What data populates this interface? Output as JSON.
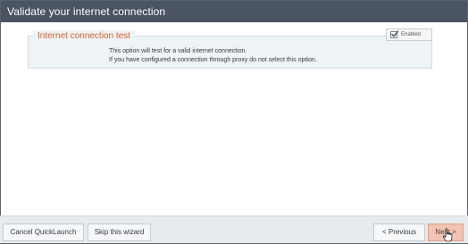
{
  "window": {
    "title": "Validate your internet connection"
  },
  "section": {
    "legend": "Internet connection test",
    "toggle_label": "Enabled",
    "toggle_checked": true,
    "description_line1": "This option will test for a valid internet connection.",
    "description_line2": "If you have configured a connection through proxy do not select this option."
  },
  "footer": {
    "cancel_label": "Cancel QuickLaunch",
    "skip_label": "Skip this wizard",
    "previous_label": "< Previous",
    "next_label": "Next >"
  },
  "colors": {
    "titlebar": "#4a5462",
    "legend_accent": "#d6622f",
    "next_button": "#f1c4b4"
  },
  "icons": {
    "checkbox": "checkmark-icon",
    "cursor": "hand-pointer-icon"
  }
}
